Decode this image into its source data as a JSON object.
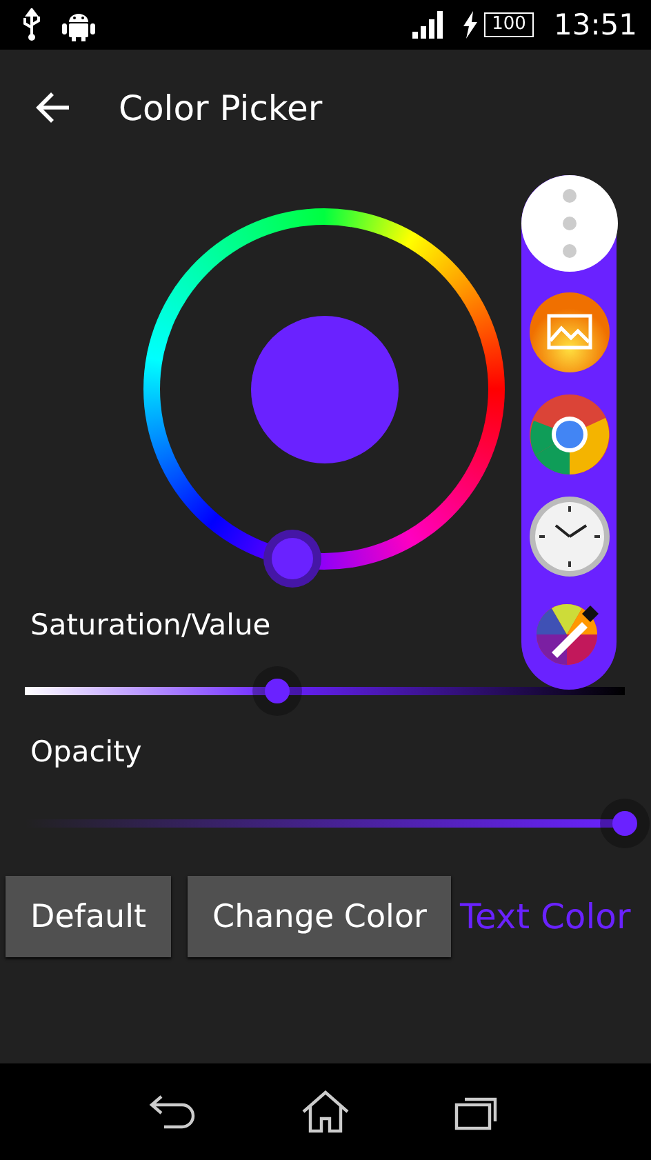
{
  "status_bar": {
    "battery": "100",
    "time": "13:51"
  },
  "app_bar": {
    "title": "Color Picker"
  },
  "color_wheel": {
    "color": "#6a22ff"
  },
  "sliders": [
    {
      "label": "Saturation/Value",
      "kind": "value",
      "level": 0.42
    },
    {
      "label": "Opacity",
      "kind": "opacity",
      "level": 1
    }
  ],
  "buttons": [
    "Default",
    "Change Color"
  ],
  "text_color_label": "Text Color"
}
